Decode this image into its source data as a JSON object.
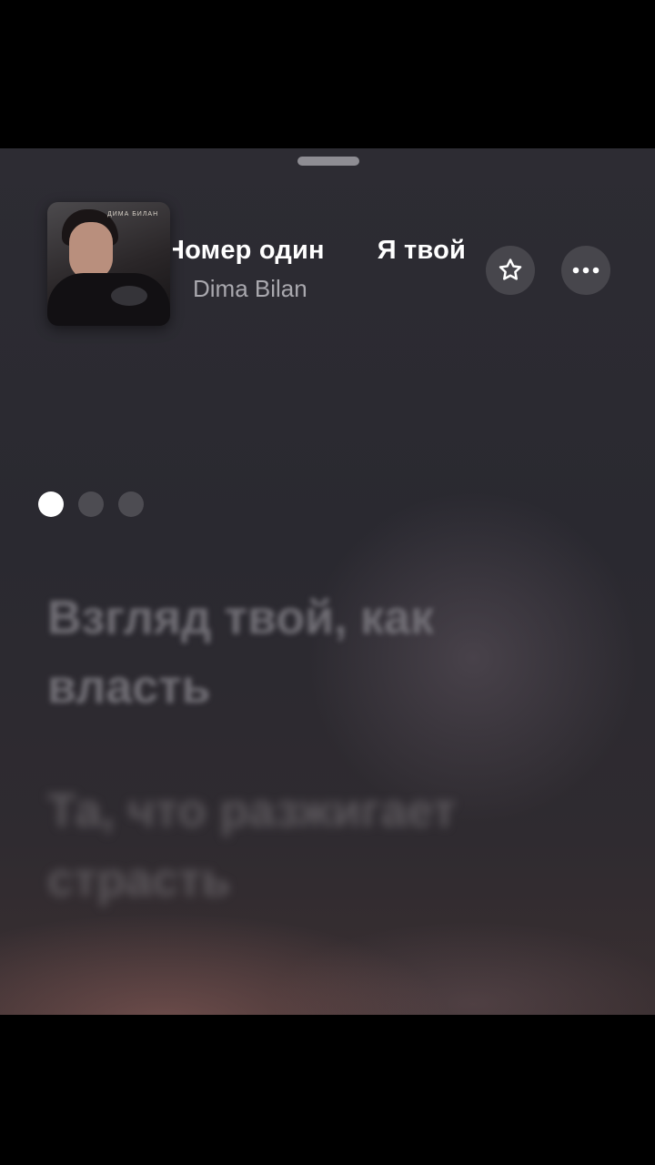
{
  "track": {
    "title_current": "Номер один",
    "title_next": "Я твой",
    "artist": "Dima Bilan"
  },
  "album_art": {
    "brand_text": "ДИМА БИЛАН"
  },
  "actions": {
    "favorite_icon": "star-outline-icon",
    "more_icon": "ellipsis-icon"
  },
  "pager": {
    "pages": 3,
    "active_index": 0
  },
  "lyrics": {
    "line1": "Взгляд твой, как власть",
    "line2": "Та, что разжигает страсть"
  },
  "colors": {
    "background": "#2c2b32",
    "accent_text": "#ffffff",
    "secondary_text": "#a9a8ae"
  }
}
